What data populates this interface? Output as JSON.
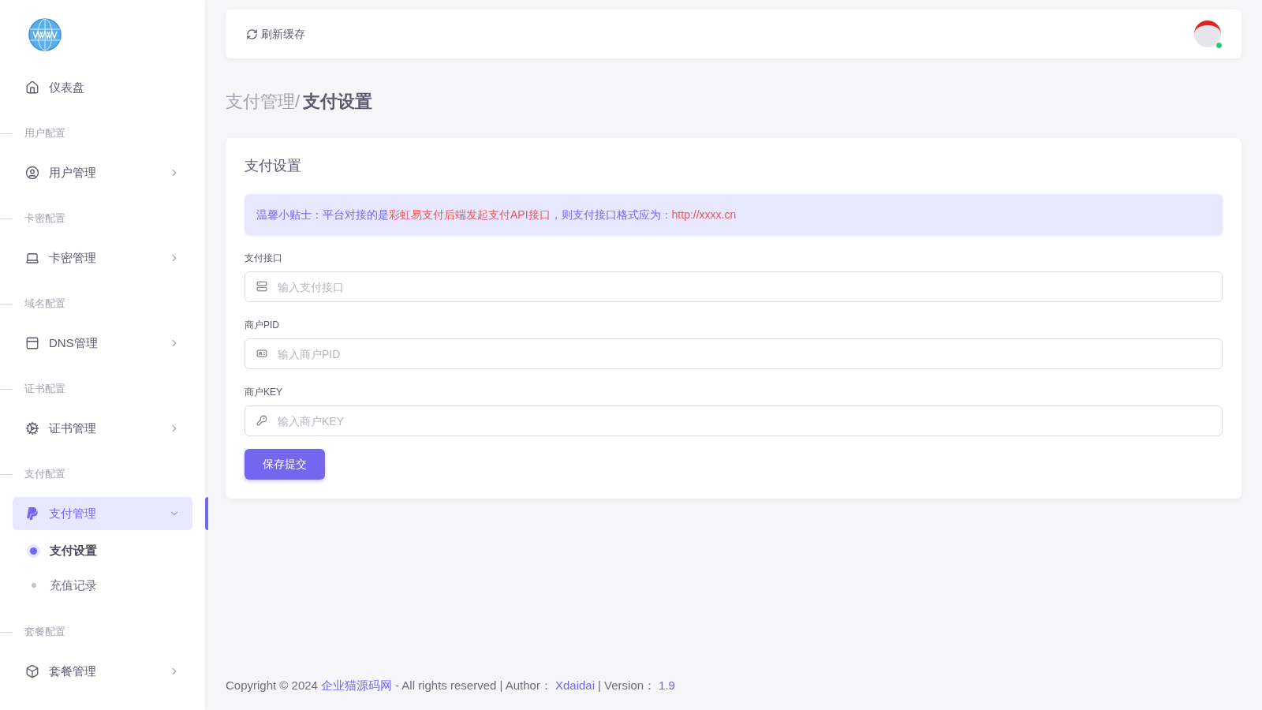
{
  "header": {
    "refresh_label": "刷新缓存",
    "user": {
      "online": true
    }
  },
  "sidebar": {
    "items": [
      {
        "kind": "link",
        "label": "仪表盘"
      },
      {
        "kind": "section",
        "label": "用户配置"
      },
      {
        "kind": "group",
        "label": "用户管理",
        "expanded": false
      },
      {
        "kind": "section",
        "label": "卡密配置"
      },
      {
        "kind": "group",
        "label": "卡密管理",
        "expanded": false
      },
      {
        "kind": "section",
        "label": "域名配置"
      },
      {
        "kind": "group",
        "label": "DNS管理",
        "expanded": false
      },
      {
        "kind": "section",
        "label": "证书配置"
      },
      {
        "kind": "group",
        "label": "证书管理",
        "expanded": false
      },
      {
        "kind": "section",
        "label": "支付配置"
      },
      {
        "kind": "group",
        "label": "支付管理",
        "expanded": true,
        "children": [
          {
            "label": "支付设置",
            "selected": true
          },
          {
            "label": "充值记录",
            "selected": false
          }
        ]
      },
      {
        "kind": "section",
        "label": "套餐配置"
      },
      {
        "kind": "group",
        "label": "套餐管理",
        "expanded": false
      }
    ]
  },
  "breadcrumb": {
    "parent": "支付管理/",
    "current": "支付设置"
  },
  "card": {
    "title": "支付设置",
    "tip": [
      {
        "text": "温馨小贴士：平台对接的是",
        "emphasis": false
      },
      {
        "text": "彩虹易支付后端发起支付API接口",
        "emphasis": true
      },
      {
        "text": "，则支付接口格式应为：",
        "emphasis": false
      },
      {
        "text": "http://xxxx.cn",
        "emphasis": true
      }
    ],
    "fields": [
      {
        "label": "支付接口",
        "placeholder": "输入支付接口"
      },
      {
        "label": "商户PID",
        "placeholder": "输入商户PID"
      },
      {
        "label": "商户KEY",
        "placeholder": "输入商户KEY"
      }
    ],
    "submit": "保存提交"
  },
  "footer": [
    {
      "kind": "text",
      "text": "Copyright © 2024"
    },
    {
      "kind": "link",
      "text": "企业猫源码网"
    },
    {
      "kind": "text",
      "text": "- All rights reserved | Author："
    },
    {
      "kind": "link",
      "text": "Xdaidai"
    },
    {
      "kind": "text",
      "text": "| Version："
    },
    {
      "kind": "link",
      "text": "1.9"
    }
  ]
}
